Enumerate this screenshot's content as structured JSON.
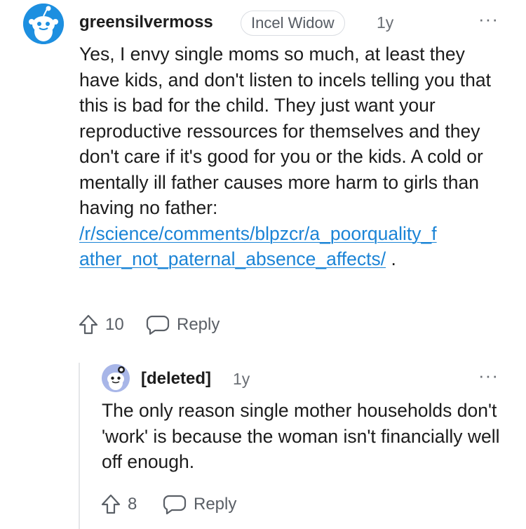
{
  "comment": {
    "username": "greensilvermoss",
    "flair": "Incel Widow",
    "age": "1y",
    "more": "···",
    "body": "Yes, I envy single moms so much, at least they have kids, and don't listen to incels telling you that this is bad for the child. They just want your reproductive ressources for themselves and they don't care if it's good for you or the kids. A cold or mentally ill father causes more harm to girls than having no father:",
    "link_line1": "/r/science/comments/blpzcr/a_poorquality_f",
    "link_line2": "ather_not_paternal_absence_affects/",
    "trailing": ".",
    "votes": "10",
    "reply_label": "Reply",
    "icons": [
      "reddit-snoo-avatar-icon",
      "upvote-icon",
      "reply-bubble-icon",
      "more-options-icon"
    ]
  },
  "reply": {
    "username": "[deleted]",
    "age": "1y",
    "more": "···",
    "body": "The only reason single mother households don't 'work' is because the woman isn't financially well off enough.",
    "votes": "8",
    "reply_label": "Reply",
    "icons": [
      "reddit-snoo-avatar-icon",
      "upvote-icon",
      "reply-bubble-icon",
      "more-options-icon"
    ]
  },
  "colors": {
    "link": "#1b84d6",
    "avatar_blue": "#1d8fe0",
    "muted": "#6b6f75"
  }
}
